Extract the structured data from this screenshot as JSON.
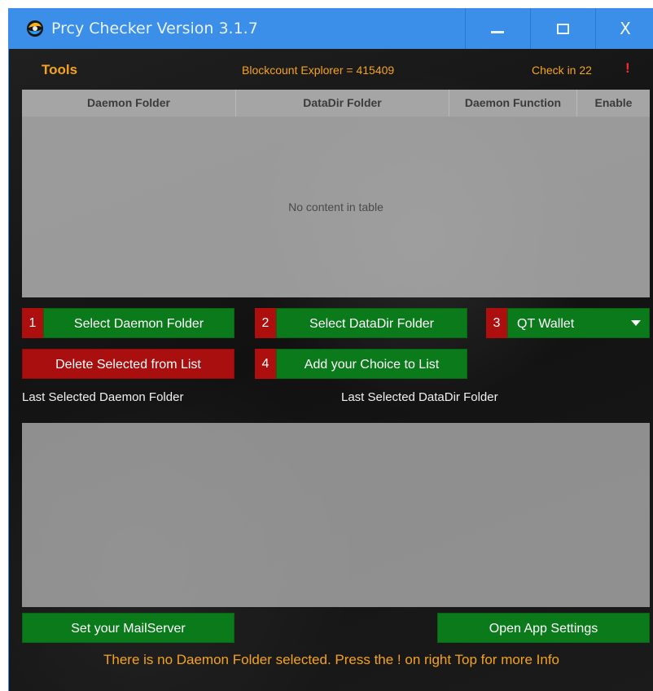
{
  "window": {
    "title": "Prcy Checker Version 3.1.7",
    "controls": {
      "minimize": "minimize-icon",
      "maximize": "maximize-icon",
      "close": "X"
    }
  },
  "topbar": {
    "tools": "Tools",
    "blockcount": "Blockcount Explorer = 415409",
    "check_in": "Check in 22",
    "info": "!"
  },
  "table": {
    "headers": [
      "Daemon Folder",
      "DataDir Folder",
      "Daemon Function",
      "Enable"
    ],
    "empty_message": "No content in table"
  },
  "actions": {
    "step1": {
      "number": "1",
      "label": "Select Daemon Folder"
    },
    "step2": {
      "number": "2",
      "label": "Select DataDir Folder"
    },
    "step3": {
      "number": "3",
      "selected": "QT Wallet"
    },
    "step4": {
      "number": "4",
      "label": "Add your Choice  to List"
    },
    "delete": "Delete Selected from List"
  },
  "labels": {
    "last_daemon": "Last Selected Daemon Folder",
    "last_datadir": "Last Selected DataDir Folder"
  },
  "footer": {
    "mailserver": "Set your MailServer",
    "settings": "Open App Settings",
    "message": "There is no Daemon Folder selected. Press the ! on right Top for more Info"
  },
  "colors": {
    "titlebar": "#3c8fe8",
    "accent_orange": "#f5a31c",
    "button_green": "#0b7a1a",
    "button_red": "#a90f0f",
    "alert_red": "#ff2a2a"
  }
}
